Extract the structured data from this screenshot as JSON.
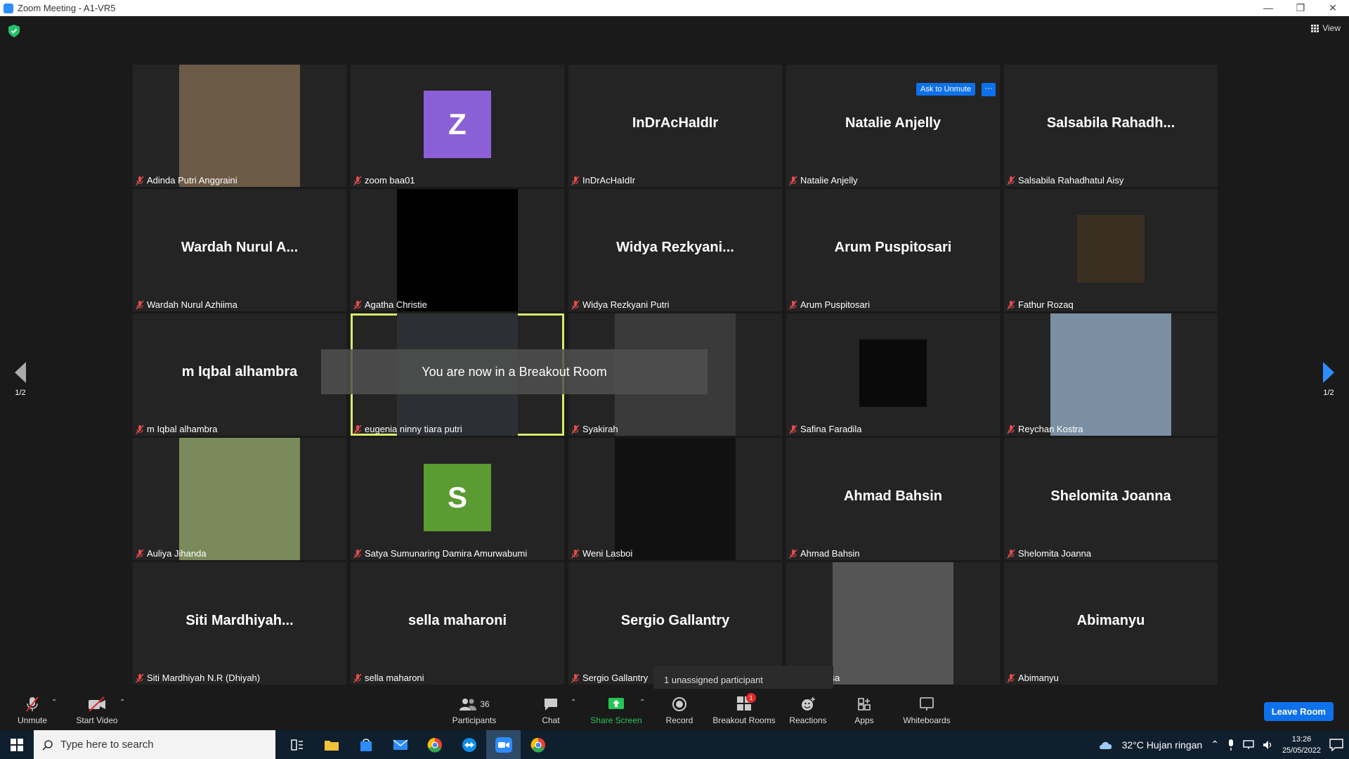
{
  "window": {
    "title": "Zoom Meeting - A1-VR5",
    "controls": [
      "—",
      "❐",
      "✕"
    ]
  },
  "view_button": {
    "label": "View"
  },
  "toast": "You are now in a Breakout Room",
  "ask_unmute": {
    "label": "Ask to Unmute",
    "more": "···"
  },
  "unassigned": "1 unassigned participant",
  "pager": {
    "left": "1/2",
    "right": "1/2"
  },
  "tiles": [
    {
      "name": "Adinda Putri Anggraini",
      "kind": "video",
      "color": "#6b5a45"
    },
    {
      "name": "zoom baa01",
      "kind": "avatar",
      "letter": "Z",
      "color": "#8b5fd6"
    },
    {
      "name": "InDrAcHaIdIr",
      "kind": "text",
      "big": "InDrAcHaIdIr"
    },
    {
      "name": "Natalie Anjelly",
      "kind": "text",
      "big": "Natalie Anjelly"
    },
    {
      "name": "Salsabila Rahadhatul Aisy",
      "kind": "text",
      "big": "Salsabila  Rahadh..."
    },
    {
      "name": "Wardah Nurul Azhiima",
      "kind": "text",
      "big": "Wardah  Nurul  A..."
    },
    {
      "name": "Agatha Christie",
      "kind": "video",
      "color": "#000000"
    },
    {
      "name": "Widya Rezkyani Putri",
      "kind": "text",
      "big": "Widya  Rezkyani..."
    },
    {
      "name": "Arum Puspitosari",
      "kind": "text",
      "big": "Arum Puspitosari"
    },
    {
      "name": "Fathur Rozaq",
      "kind": "smallvideo",
      "color": "#3a3022"
    },
    {
      "name": "m Iqbal alhambra",
      "kind": "text",
      "big": "m Iqbal alhambra"
    },
    {
      "name": "eugenia ninny tiara putri",
      "kind": "video",
      "color": "#2c2f33",
      "active": true
    },
    {
      "name": "Syakirah",
      "kind": "video",
      "color": "#3a3a3a"
    },
    {
      "name": "Safina Faradila",
      "kind": "smallvideo",
      "color": "#0a0a0a"
    },
    {
      "name": "Reychan Kostra",
      "kind": "video",
      "color": "#7b8fa3"
    },
    {
      "name": "Auliya Jihanda",
      "kind": "video",
      "color": "#7a8a5a"
    },
    {
      "name": "Satya Sumunaring Damira Amurwabumi",
      "kind": "avatar",
      "letter": "S",
      "color": "#5a9b32"
    },
    {
      "name": "Weni Lasboi",
      "kind": "video",
      "color": "#111111"
    },
    {
      "name": "Ahmad Bahsin",
      "kind": "text",
      "big": "Ahmad Bahsin"
    },
    {
      "name": "Shelomita Joanna",
      "kind": "text",
      "big": "Shelomita Joanna"
    },
    {
      "name": "Siti Mardhiyah N.R (Dhiyah)",
      "kind": "text",
      "big": "Siti  Mardhiyah..."
    },
    {
      "name": "sella maharoni",
      "kind": "text",
      "big": "sella maharoni"
    },
    {
      "name": "Sergio Gallantry",
      "kind": "text",
      "big": "Sergio Gallantry"
    },
    {
      "name": "a Merissa",
      "kind": "video",
      "color": "#555555"
    },
    {
      "name": "Abimanyu",
      "kind": "text",
      "big": "Abimanyu"
    }
  ],
  "toolbar": {
    "unmute": "Unmute",
    "start_video": "Start Video",
    "participants": "Participants",
    "participants_count": "36",
    "chat": "Chat",
    "share_screen": "Share Screen",
    "record": "Record",
    "breakout_rooms": "Breakout Rooms",
    "breakout_badge": "1",
    "reactions": "Reactions",
    "apps": "Apps",
    "whiteboards": "Whiteboards",
    "leave": "Leave Room"
  },
  "taskbar": {
    "search_placeholder": "Type here to search",
    "weather": "32°C  Hujan ringan",
    "time": "13:26",
    "date": "25/05/2022"
  }
}
